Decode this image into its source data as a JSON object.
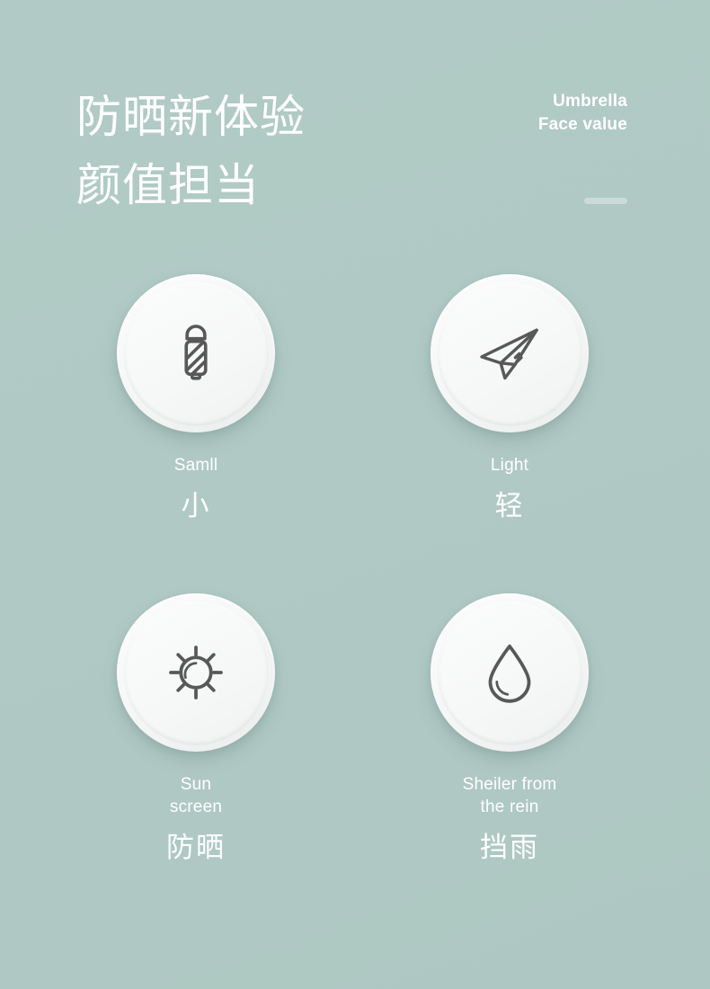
{
  "theme": {
    "background_color": "#b0c9c4",
    "text_color": "#ffffff",
    "disc_color": "#f7f8f8",
    "icon_stroke_color": "#585858",
    "rule_color": "#cbdcd8"
  },
  "header": {
    "headline_line1": "防晒新体验",
    "headline_line2": "颜值担当",
    "eyebrow_line1": "Umbrella",
    "eyebrow_line2": "Face value"
  },
  "features": [
    {
      "icon": "folded-umbrella-icon",
      "english_lines": [
        "Samll"
      ],
      "chinese": "小"
    },
    {
      "icon": "paper-plane-icon",
      "english_lines": [
        "Light"
      ],
      "chinese": "轻"
    },
    {
      "icon": "sun-icon",
      "english_lines": [
        "Sun",
        "screen"
      ],
      "chinese": "防晒"
    },
    {
      "icon": "water-drop-icon",
      "english_lines": [
        "Sheiler from",
        "the rein"
      ],
      "chinese": "挡雨"
    }
  ]
}
